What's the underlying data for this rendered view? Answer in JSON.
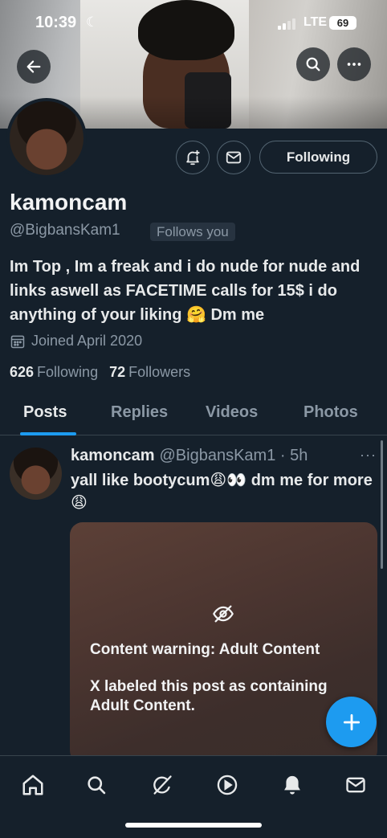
{
  "status_bar": {
    "time": "10:39",
    "moon": "☾",
    "network": "LTE",
    "battery": "69"
  },
  "profile": {
    "name": "kamoncam",
    "handle": "@BigbansKam1",
    "follows_badge": "Follows you",
    "bio": "Im Top , Im a freak and i do nude for nude and links aswell as FACETIME calls for 15$ i do anything of your liking 🤗 Dm me",
    "joined": "Joined April 2020",
    "following_count": "626",
    "following_label": "Following",
    "followers_count": "72",
    "followers_label": "Followers",
    "following_button": "Following"
  },
  "tabs": [
    {
      "label": "Posts",
      "active": true
    },
    {
      "label": "Replies",
      "active": false
    },
    {
      "label": "Videos",
      "active": false
    },
    {
      "label": "Photos",
      "active": false
    }
  ],
  "post": {
    "author": "kamoncam",
    "handle_time": "@BigbansKam1 · 5h",
    "more": "···",
    "text": "yall like bootycum😩👀 dm me for more😩",
    "content_warning_title": "Content warning: Adult Content",
    "content_warning_body": "X labeled this post as containing Adult Content."
  },
  "colors": {
    "accent": "#1d9bf0",
    "background": "#15202b",
    "secondary_text": "#8b98a5"
  },
  "icons": {
    "header": [
      "back-arrow-icon",
      "search-icon",
      "more-icon"
    ],
    "profile_actions": [
      "bell-plus-icon",
      "mail-icon"
    ],
    "bottom_nav": [
      "home-icon",
      "search-icon",
      "grok-icon",
      "play-icon",
      "bell-icon",
      "mail-icon"
    ],
    "fab": "plus-icon"
  }
}
